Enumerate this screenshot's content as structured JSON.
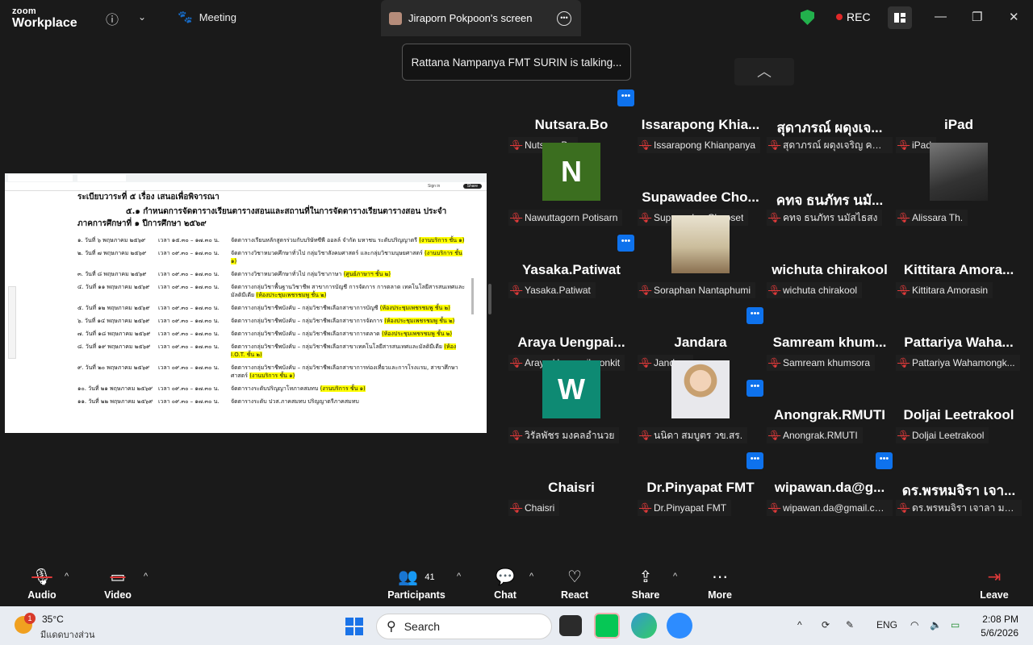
{
  "topbar": {
    "logo_line1": "zoom",
    "logo_line2": "Workplace",
    "meeting_label": "Meeting",
    "share_tab_label": "Jiraporn Pokpoon's screen",
    "rec_label": "REC"
  },
  "toast": {
    "text": "Rattana Nampanya FMT SURIN is talking..."
  },
  "shared_doc": {
    "heading": "ระเบียบวาระที่ ๕ เรื่อง เสนอเพื่อพิจารณา",
    "subheading": "๕.๑ กำหนดการจัดตารางเรียนตารางสอนและสถานที่ในการจัดตารางเรียนตารางสอน ประจำ",
    "subheading2": "ภาคการศึกษาที่ ๑ ปีการศึกษา ๒๕๖๙",
    "share_button": "Share",
    "sign_in": "Sign in",
    "rows": [
      {
        "date": "๑. วันที่ ๖ พฤษภาคม ๒๕๖๙",
        "time": "เวลา ๑๕.๓๐ – ๑๗.๓๐ น.",
        "desc": "จัดตารางเรียนหลักสูตรร่วมกับบริษัทซีพี ออลล์ จำกัด มหาชน ระดับปริญญาตรี",
        "room": "(งานบริการ ชั้น ๑)"
      },
      {
        "date": "๒. วันที่ ๗ พฤษภาคม ๒๕๖๙",
        "time": "เวลา ๐๙.๓๐ – ๑๗.๓๐ น.",
        "desc": "จัดตารางวิชาหมวดศึกษาทั่วไป กลุ่มวิชาสังคมศาสตร์ และกลุ่มวิชามนุษยศาสตร์",
        "room": "(งานบริการ ชั้น ๑)"
      },
      {
        "date": "๓. วันที่ ๘ พฤษภาคม ๒๕๖๙",
        "time": "เวลา ๐๙.๓๐ – ๑๗.๓๐ น.",
        "desc": "จัดตารางวิชาหมวดศึกษาทั่วไป กลุ่มวิชาภาษา",
        "room": "(ศูนย์ภาษาฯ ชั้น ๒)"
      },
      {
        "date": "๔. วันที่ ๑๑ พฤษภาคม ๒๕๖๙",
        "time": "เวลา ๐๙.๓๐ – ๑๗.๓๐ น.",
        "desc": "จัดตารางกลุ่มวิชาพื้นฐานวิชาชีพ สาขาการบัญชี การจัดการ การตลาด เทคโนโลยีสารสนเทศและมัลติมีเดีย",
        "room": "(ห้องประชุมเพชรชมพู ชั้น ๒)"
      },
      {
        "date": "๕. วันที่ ๑๒ พฤษภาคม ๒๕๖๙",
        "time": "เวลา ๐๙.๓๐ – ๑๗.๓๐ น.",
        "desc": "จัดตารางกลุ่มวิชาชีพบังคับ – กลุ่มวิชาชีพเลือกสาขาการบัญชี",
        "room": "(ห้องประชุมเพชรชมพู ชั้น ๒)"
      },
      {
        "date": "๖. วันที่ ๑๔ พฤษภาคม ๒๕๖๙",
        "time": "เวลา ๐๙.๓๐ – ๑๗.๓๐ น.",
        "desc": "จัดตารางกลุ่มวิชาชีพบังคับ – กลุ่มวิชาชีพเลือกสาขาการจัดการ",
        "room": "(ห้องประชุมเพชรชมพู ชั้น ๒)"
      },
      {
        "date": "๗. วันที่ ๑๘ พฤษภาคม ๒๕๖๙",
        "time": "เวลา ๐๙.๓๐ – ๑๗.๓๐ น.",
        "desc": "จัดตารางกลุ่มวิชาชีพบังคับ – กลุ่มวิชาชีพเลือกสาขาการตลาด",
        "room": "(ห้องประชุมเพชรชมพู ชั้น ๒)"
      },
      {
        "date": "๘. วันที่ ๑๙ พฤษภาคม ๒๕๖๙",
        "time": "เวลา ๐๙.๓๐ – ๑๗.๓๐ น.",
        "desc": "จัดตารางกลุ่มวิชาชีพบังคับ – กลุ่มวิชาชีพเลือกสาขาเทคโนโลยีสารสนเทศและมัลติมีเดีย",
        "room": "(ห้อง I.O.T. ชั้น ๒)"
      },
      {
        "date": "๙. วันที่ ๒๐ พฤษภาคม ๒๕๖๙",
        "time": "เวลา ๐๙.๓๐ – ๑๗.๓๐ น.",
        "desc": "จัดตารางกลุ่มวิชาชีพบังคับ – กลุ่มวิชาชีพเลือกสาขาการท่องเที่ยวและการโรงแรม, สาขาศึกษาศาสตร์",
        "room": "(งานบริการ ชั้น ๑)"
      },
      {
        "date": "๑๐. วันที่ ๒๑ พฤษภาคม ๒๕๖๙",
        "time": "เวลา ๐๙.๓๐ – ๑๗.๓๐ น.",
        "desc": "จัดตารางระดับปริญญาโทภาคสมทบ",
        "room": "(งานบริการ ชั้น ๑)"
      },
      {
        "date": "๑๑. วันที่ ๒๒ พฤษภาคม ๒๕๖๙",
        "time": "เวลา ๐๙.๓๐ – ๑๗.๓๐ น.",
        "desc": "จัดตารางระดับ ปวส.ภาคสมทบ ปริญญาตรีภาคสมทบ",
        "room": ""
      }
    ]
  },
  "participants": [
    {
      "name": "Nutsara.Bo",
      "label": "Nutsara.Bo"
    },
    {
      "name": "Issarapong  Khia...",
      "label": "Issarapong Khianpanya"
    },
    {
      "name": "สุดาภรณ์  ผดุงเจ...",
      "label": "สุดาภรณ์  ผดุงเจริญ คทจ...."
    },
    {
      "name": "iPad",
      "label": "iPad"
    },
    {
      "name": "",
      "label": "Nawuttagorn Potisarn",
      "avatar": "N",
      "avatar_color": "#3b6e1f"
    },
    {
      "name": "Supawadee  Cho...",
      "label": "Supawadee Chopset"
    },
    {
      "name": "คทจ  ธนภัทร นมั...",
      "label": "คทจ  ธนภัทร นมัสไธสง"
    },
    {
      "name": "",
      "label": "Alissara Th.",
      "photo": "person-dark"
    },
    {
      "name": "Yasaka.Patiwat",
      "label": "Yasaka.Patiwat"
    },
    {
      "name": "",
      "label": "Soraphan Nantaphumi",
      "photo": "book"
    },
    {
      "name": "wichuta chirakool",
      "label": "wichuta chirakool"
    },
    {
      "name": "Kittitara  Amora...",
      "label": "Kittitara Amorasin"
    },
    {
      "name": "Araya  Uengpai...",
      "label": "Araya Uengpaiboonkit"
    },
    {
      "name": "Jandara",
      "label": "Jandara"
    },
    {
      "name": "Samream  khum...",
      "label": "Samream khumsora"
    },
    {
      "name": "Pattariya  Waha...",
      "label": "Pattariya Wahamongk..."
    },
    {
      "name": "",
      "label": "วิรัลพัชร มงคลอำนวย",
      "avatar": "W",
      "avatar_color": "#0e8a73"
    },
    {
      "name": "",
      "label": "นนิดา สมบูตร วข.สร.",
      "photo": "woman"
    },
    {
      "name": "Anongrak.RMUTI",
      "label": "Anongrak.RMUTI"
    },
    {
      "name": "Doljai Leetrakool",
      "label": "Doljai Leetrakool"
    },
    {
      "name": "Chaisri",
      "label": "Chaisri"
    },
    {
      "name": "Dr.Pinyapat FMT",
      "label": "Dr.Pinyapat FMT"
    },
    {
      "name": "wipawan.da@g...",
      "label": "wipawan.da@gmail.co..."
    },
    {
      "name": "ดร.พรหมจิรา เจา...",
      "label": "ดร.พรหมจิรา เจาลา มทร.อีสา..."
    }
  ],
  "controls": {
    "audio": "Audio",
    "video": "Video",
    "participants": "Participants",
    "participants_count": "41",
    "chat": "Chat",
    "react": "React",
    "share": "Share",
    "more": "More",
    "leave": "Leave"
  },
  "taskbar": {
    "weather_temp": "35°C",
    "weather_desc": "มีแดดบางส่วน",
    "weather_badge": "1",
    "search_placeholder": "Search",
    "lang": "ENG",
    "time": "2:08 PM",
    "date": "5/6/2026"
  },
  "colors": {
    "accent": "#0e72ed",
    "mic_muted": "#e23a3a",
    "shield": "#22b14c",
    "rec": "#e02828"
  }
}
